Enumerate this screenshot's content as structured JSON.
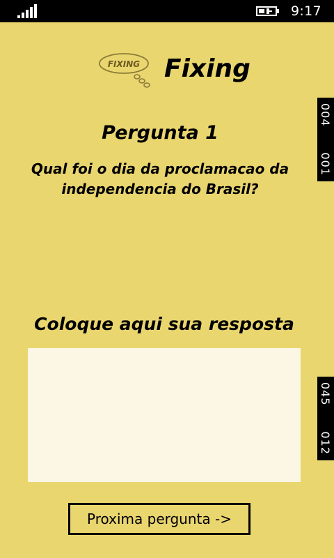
{
  "status_bar": {
    "time": "9:17",
    "signal_icon": "signal-icon",
    "battery_icon": "battery-charging-icon"
  },
  "header": {
    "logo_text": "FIXING",
    "title": "Fixing"
  },
  "question": {
    "heading": "Pergunta 1",
    "text": "Qual foi o dia da proclamacao da independencia do Brasil?"
  },
  "answer": {
    "label": "Coloque aqui sua resposta",
    "value": "",
    "placeholder": ""
  },
  "next_button": {
    "label": "Proxima pergunta ->"
  },
  "side_counters": {
    "top": {
      "first": "004",
      "second": "001"
    },
    "bottom": {
      "first": "045",
      "second": "012"
    }
  },
  "colors": {
    "background": "#EAD66F",
    "input_background": "#FCF6E5",
    "status_bar": "#000000"
  }
}
